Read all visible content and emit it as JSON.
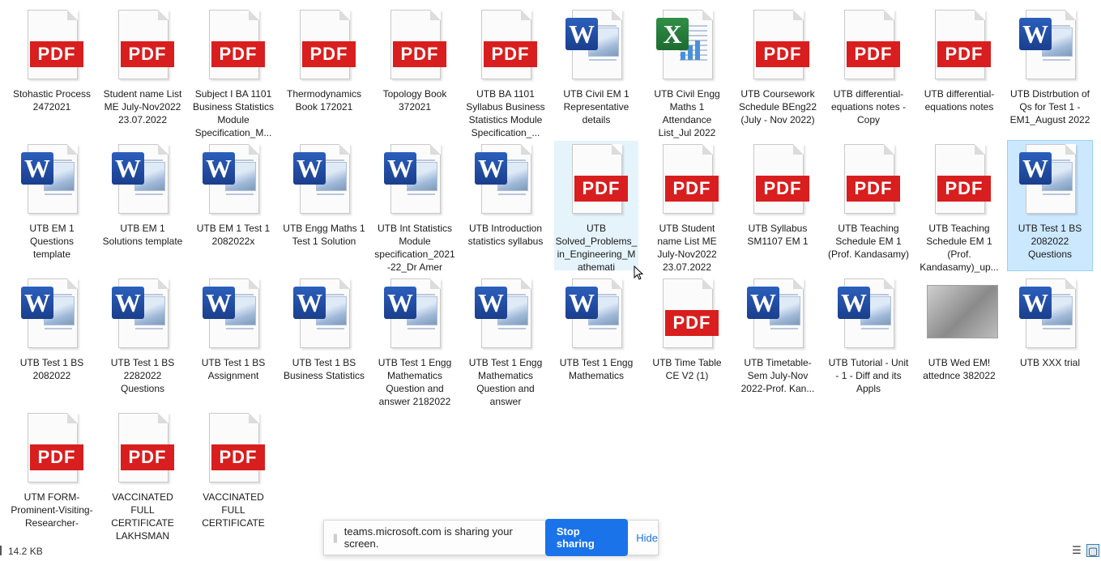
{
  "files": [
    {
      "name": "Stohastic Process 2472021",
      "type": "pdf"
    },
    {
      "name": "Student name List ME July-Nov2022 23.07.2022",
      "type": "pdf"
    },
    {
      "name": "Subject I BA 1101 Business Statistics Module Specification_M...",
      "type": "pdf"
    },
    {
      "name": "Thermodynamics Book 172021",
      "type": "pdf"
    },
    {
      "name": "Topology Book 372021",
      "type": "pdf"
    },
    {
      "name": "UTB BA 1101 Syllabus Business Statistics Module Specification_...",
      "type": "pdf"
    },
    {
      "name": "UTB Civil EM 1 Representative details",
      "type": "word"
    },
    {
      "name": "UTB Civil Engg Maths 1 Attendance List_Jul 2022",
      "type": "excel"
    },
    {
      "name": "UTB Coursework Schedule BEng22 (July - Nov 2022)",
      "type": "pdf"
    },
    {
      "name": "UTB differential-equations notes - Copy",
      "type": "pdf"
    },
    {
      "name": "UTB differential-equations notes",
      "type": "pdf"
    },
    {
      "name": "UTB Distrbution of Qs for Test 1 - EM1_August 2022",
      "type": "word"
    },
    {
      "name": "UTB EM 1 Questions template",
      "type": "word"
    },
    {
      "name": "UTB EM 1 Solutions template",
      "type": "word"
    },
    {
      "name": "UTB EM 1 Test 1 2082022x",
      "type": "word"
    },
    {
      "name": "UTB Engg Maths 1  Test 1 Solution",
      "type": "word"
    },
    {
      "name": "UTB Int Statistics Module specification_2021-22_Dr Amer",
      "type": "word"
    },
    {
      "name": "UTB Introduction statistics syllabus",
      "type": "word"
    },
    {
      "name": "UTB Solved_Problems_in_Engineering_Mathemati",
      "type": "pdf",
      "state": "hover"
    },
    {
      "name": "UTB Student name List ME July-Nov2022 23.07.2022",
      "type": "pdf"
    },
    {
      "name": "UTB Syllabus SM1107 EM 1",
      "type": "pdf"
    },
    {
      "name": "UTB Teaching Schedule EM 1 (Prof. Kandasamy)",
      "type": "pdf"
    },
    {
      "name": "UTB Teaching Schedule EM 1 (Prof. Kandasamy)_up...",
      "type": "pdf"
    },
    {
      "name": "UTB Test 1 BS 2082022 Questions",
      "type": "word",
      "state": "selected"
    },
    {
      "name": "UTB Test 1 BS 2082022",
      "type": "word"
    },
    {
      "name": "UTB Test 1 BS 2282022 Questions",
      "type": "word"
    },
    {
      "name": "UTB Test 1 BS Assignment",
      "type": "word"
    },
    {
      "name": "UTB Test 1 BS Business Statistics",
      "type": "word"
    },
    {
      "name": "UTB Test 1 Engg Mathematics Question and answer 2182022",
      "type": "word"
    },
    {
      "name": "UTB Test 1 Engg Mathematics Question and answer",
      "type": "word"
    },
    {
      "name": "UTB Test 1 Engg Mathematics",
      "type": "word"
    },
    {
      "name": "UTB Time Table CE V2 (1)",
      "type": "pdf"
    },
    {
      "name": "UTB Timetable-Sem July-Nov 2022-Prof. Kan...",
      "type": "word"
    },
    {
      "name": "UTB Tutorial - Unit - 1 - Diff and its Appls",
      "type": "word"
    },
    {
      "name": "UTB Wed EM! attednce 382022",
      "type": "image"
    },
    {
      "name": "UTB XXX trial",
      "type": "word"
    },
    {
      "name": "UTM FORM-Prominent-Visiting-Researcher-",
      "type": "pdf"
    },
    {
      "name": "VACCINATED FULL CERTIFICATE LAKHSMAN",
      "type": "pdf"
    },
    {
      "name": "VACCINATED FULL CERTIFICATE",
      "type": "pdf"
    }
  ],
  "icons": {
    "pdf_badge": "PDF",
    "word_letter": "W",
    "excel_letter": "X"
  },
  "colors": {
    "pdf_red": "#d81e1e",
    "word_blue": "#2b5fbd",
    "excel_green": "#2f8f46",
    "selection": "#cce8ff",
    "hover": "#e5f3fb",
    "teams_blue": "#1a73e8"
  },
  "status_bar": {
    "size": "14.2 KB"
  },
  "share_bar": {
    "handle": "||",
    "message": "teams.microsoft.com is sharing your screen.",
    "stop_label": "Stop sharing",
    "hide_label": "Hide"
  },
  "view_buttons": {
    "details_glyph": "☰",
    "tiles_glyph": "▢"
  }
}
